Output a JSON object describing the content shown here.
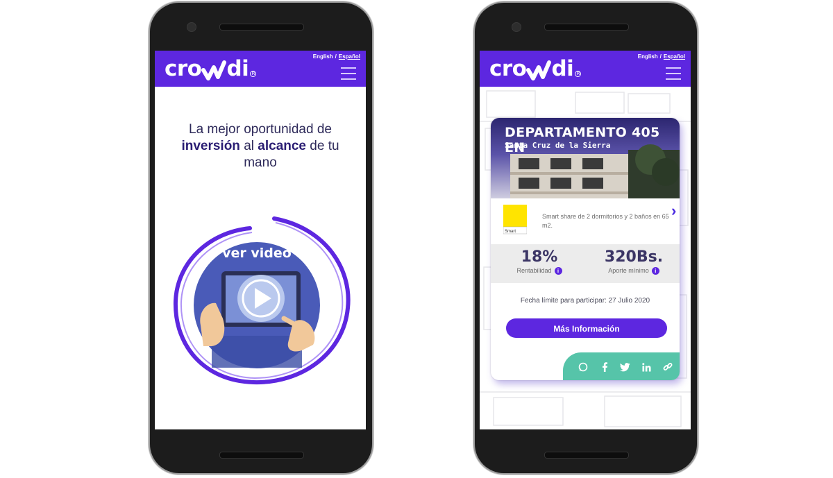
{
  "brand": {
    "name": "crowdi",
    "color": "#5d27e0"
  },
  "language": {
    "english": "English",
    "separator": "/",
    "spanish": "Español",
    "active": "Español"
  },
  "left_screen": {
    "tagline_pre": "La mejor oportunidad de ",
    "tagline_bold_1": "inversión",
    "tagline_mid": " al ",
    "tagline_bold_2": "alcance",
    "tagline_post": " de tu mano",
    "video_label": "ver video"
  },
  "right_screen": {
    "card": {
      "title": "DEPARTAMENTO 405 EN",
      "subtitle": "Santa Cruz de la Sierra",
      "partner_logo_text": "Smart",
      "description": "Smart share de 2 dormitorios y 2 baños en 65 m2.",
      "stats": [
        {
          "value": "18%",
          "label": "Rentabilidad"
        },
        {
          "value": "320Bs.",
          "label": "Aporte mínimo"
        }
      ],
      "deadline": "Fecha límite para participar: 27 Julio 2020",
      "cta_label": "Más Información",
      "share_icons": [
        "whatsapp-icon",
        "facebook-icon",
        "twitter-icon",
        "linkedin-icon",
        "link-icon"
      ],
      "share_color": "#56c4a9"
    }
  }
}
